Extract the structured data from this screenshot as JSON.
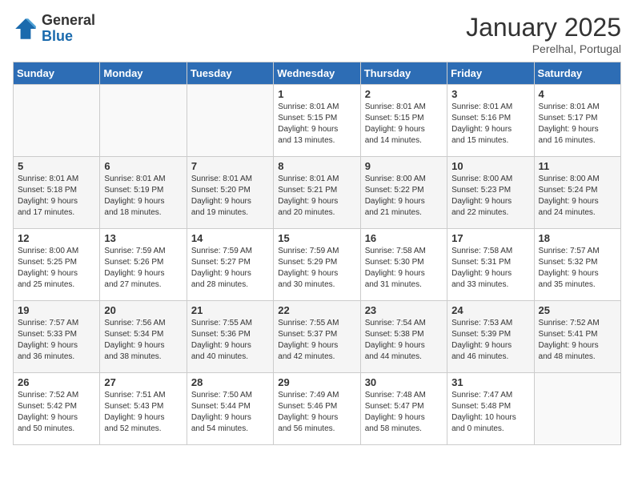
{
  "header": {
    "logo_general": "General",
    "logo_blue": "Blue",
    "title": "January 2025",
    "subtitle": "Perelhal, Portugal"
  },
  "days_of_week": [
    "Sunday",
    "Monday",
    "Tuesday",
    "Wednesday",
    "Thursday",
    "Friday",
    "Saturday"
  ],
  "weeks": [
    [
      {
        "day": "",
        "info": ""
      },
      {
        "day": "",
        "info": ""
      },
      {
        "day": "",
        "info": ""
      },
      {
        "day": "1",
        "info": "Sunrise: 8:01 AM\nSunset: 5:15 PM\nDaylight: 9 hours\nand 13 minutes."
      },
      {
        "day": "2",
        "info": "Sunrise: 8:01 AM\nSunset: 5:15 PM\nDaylight: 9 hours\nand 14 minutes."
      },
      {
        "day": "3",
        "info": "Sunrise: 8:01 AM\nSunset: 5:16 PM\nDaylight: 9 hours\nand 15 minutes."
      },
      {
        "day": "4",
        "info": "Sunrise: 8:01 AM\nSunset: 5:17 PM\nDaylight: 9 hours\nand 16 minutes."
      }
    ],
    [
      {
        "day": "5",
        "info": "Sunrise: 8:01 AM\nSunset: 5:18 PM\nDaylight: 9 hours\nand 17 minutes."
      },
      {
        "day": "6",
        "info": "Sunrise: 8:01 AM\nSunset: 5:19 PM\nDaylight: 9 hours\nand 18 minutes."
      },
      {
        "day": "7",
        "info": "Sunrise: 8:01 AM\nSunset: 5:20 PM\nDaylight: 9 hours\nand 19 minutes."
      },
      {
        "day": "8",
        "info": "Sunrise: 8:01 AM\nSunset: 5:21 PM\nDaylight: 9 hours\nand 20 minutes."
      },
      {
        "day": "9",
        "info": "Sunrise: 8:00 AM\nSunset: 5:22 PM\nDaylight: 9 hours\nand 21 minutes."
      },
      {
        "day": "10",
        "info": "Sunrise: 8:00 AM\nSunset: 5:23 PM\nDaylight: 9 hours\nand 22 minutes."
      },
      {
        "day": "11",
        "info": "Sunrise: 8:00 AM\nSunset: 5:24 PM\nDaylight: 9 hours\nand 24 minutes."
      }
    ],
    [
      {
        "day": "12",
        "info": "Sunrise: 8:00 AM\nSunset: 5:25 PM\nDaylight: 9 hours\nand 25 minutes."
      },
      {
        "day": "13",
        "info": "Sunrise: 7:59 AM\nSunset: 5:26 PM\nDaylight: 9 hours\nand 27 minutes."
      },
      {
        "day": "14",
        "info": "Sunrise: 7:59 AM\nSunset: 5:27 PM\nDaylight: 9 hours\nand 28 minutes."
      },
      {
        "day": "15",
        "info": "Sunrise: 7:59 AM\nSunset: 5:29 PM\nDaylight: 9 hours\nand 30 minutes."
      },
      {
        "day": "16",
        "info": "Sunrise: 7:58 AM\nSunset: 5:30 PM\nDaylight: 9 hours\nand 31 minutes."
      },
      {
        "day": "17",
        "info": "Sunrise: 7:58 AM\nSunset: 5:31 PM\nDaylight: 9 hours\nand 33 minutes."
      },
      {
        "day": "18",
        "info": "Sunrise: 7:57 AM\nSunset: 5:32 PM\nDaylight: 9 hours\nand 35 minutes."
      }
    ],
    [
      {
        "day": "19",
        "info": "Sunrise: 7:57 AM\nSunset: 5:33 PM\nDaylight: 9 hours\nand 36 minutes."
      },
      {
        "day": "20",
        "info": "Sunrise: 7:56 AM\nSunset: 5:34 PM\nDaylight: 9 hours\nand 38 minutes."
      },
      {
        "day": "21",
        "info": "Sunrise: 7:55 AM\nSunset: 5:36 PM\nDaylight: 9 hours\nand 40 minutes."
      },
      {
        "day": "22",
        "info": "Sunrise: 7:55 AM\nSunset: 5:37 PM\nDaylight: 9 hours\nand 42 minutes."
      },
      {
        "day": "23",
        "info": "Sunrise: 7:54 AM\nSunset: 5:38 PM\nDaylight: 9 hours\nand 44 minutes."
      },
      {
        "day": "24",
        "info": "Sunrise: 7:53 AM\nSunset: 5:39 PM\nDaylight: 9 hours\nand 46 minutes."
      },
      {
        "day": "25",
        "info": "Sunrise: 7:52 AM\nSunset: 5:41 PM\nDaylight: 9 hours\nand 48 minutes."
      }
    ],
    [
      {
        "day": "26",
        "info": "Sunrise: 7:52 AM\nSunset: 5:42 PM\nDaylight: 9 hours\nand 50 minutes."
      },
      {
        "day": "27",
        "info": "Sunrise: 7:51 AM\nSunset: 5:43 PM\nDaylight: 9 hours\nand 52 minutes."
      },
      {
        "day": "28",
        "info": "Sunrise: 7:50 AM\nSunset: 5:44 PM\nDaylight: 9 hours\nand 54 minutes."
      },
      {
        "day": "29",
        "info": "Sunrise: 7:49 AM\nSunset: 5:46 PM\nDaylight: 9 hours\nand 56 minutes."
      },
      {
        "day": "30",
        "info": "Sunrise: 7:48 AM\nSunset: 5:47 PM\nDaylight: 9 hours\nand 58 minutes."
      },
      {
        "day": "31",
        "info": "Sunrise: 7:47 AM\nSunset: 5:48 PM\nDaylight: 10 hours\nand 0 minutes."
      },
      {
        "day": "",
        "info": ""
      }
    ]
  ]
}
